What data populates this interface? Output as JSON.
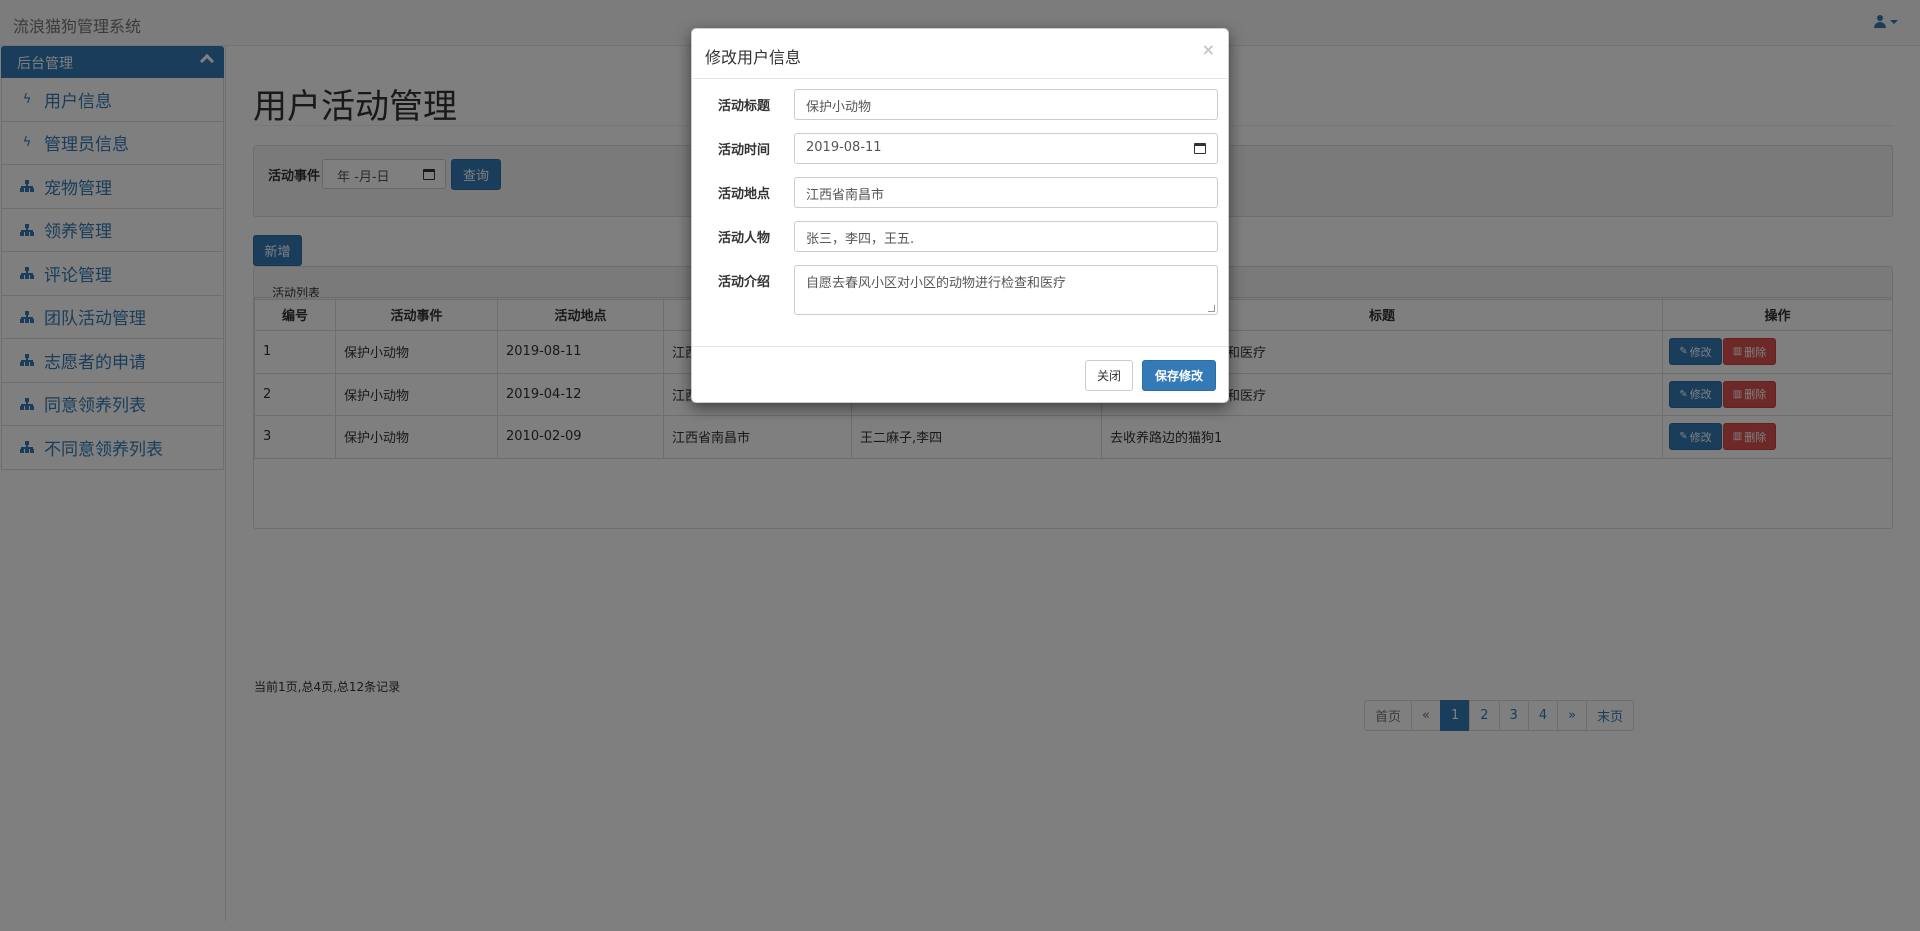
{
  "app": {
    "title": "流浪猫狗管理系统"
  },
  "sidebar": {
    "header": "后台管理",
    "items": [
      {
        "label": "用户信息",
        "icon": "bolt-icon"
      },
      {
        "label": "管理员信息",
        "icon": "bolt-icon"
      },
      {
        "label": "宠物管理",
        "icon": "sitemap-icon"
      },
      {
        "label": "领养管理",
        "icon": "sitemap-icon"
      },
      {
        "label": "评论管理",
        "icon": "sitemap-icon"
      },
      {
        "label": "团队活动管理",
        "icon": "sitemap-icon"
      },
      {
        "label": "志愿者的申请",
        "icon": "sitemap-icon"
      },
      {
        "label": "同意领养列表",
        "icon": "sitemap-icon"
      },
      {
        "label": "不同意领养列表",
        "icon": "sitemap-icon"
      }
    ]
  },
  "main": {
    "title": "用户活动管理",
    "search": {
      "label": "活动事件",
      "date_placeholder": "年 -月-日",
      "button": "查询"
    },
    "add_button": "新增",
    "list": {
      "heading": "活动列表",
      "columns": [
        "编号",
        "活动事件",
        "活动地点",
        "",
        "",
        "标题",
        "操作"
      ],
      "rows": [
        {
          "id": "1",
          "event": "保护小动物",
          "place": "2019-08-11",
          "addr": "江西",
          "people": "",
          "title": "小区的动物进行检查和医疗"
        },
        {
          "id": "2",
          "event": "保护小动物",
          "place": "2019-04-12",
          "addr": "江西",
          "people": "",
          "title": "小区的动物进行检查和医疗"
        },
        {
          "id": "3",
          "event": "保护小动物",
          "place": "2010-02-09",
          "addr": "江西省南昌市",
          "people": "王二麻子,李四",
          "title": "去收养路边的猫狗1"
        }
      ],
      "edit_label": "修改",
      "delete_label": "删除"
    },
    "page_info": "当前1页,总4页,总12条记录",
    "pager": [
      "首页",
      "«",
      "1",
      "2",
      "3",
      "4",
      "»",
      "末页"
    ]
  },
  "modal": {
    "title": "修改用户信息",
    "close_glyph": "×",
    "fields": [
      {
        "label": "活动标题",
        "value": "保护小动物"
      },
      {
        "label": "活动时间",
        "value": "2019-08-11"
      },
      {
        "label": "活动地点",
        "value": "江西省南昌市"
      },
      {
        "label": "活动人物",
        "value": "张三，李四，王五."
      },
      {
        "label": "活动介绍",
        "value": "自愿去春风小区对小区的动物进行检查和医疗"
      }
    ],
    "close_button": "关闭",
    "save_button": "保存修改"
  }
}
